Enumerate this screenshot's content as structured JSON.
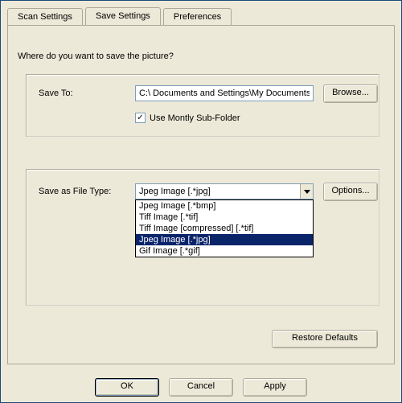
{
  "tabs": {
    "scan": "Scan Settings",
    "save": "Save Settings",
    "prefs": "Preferences"
  },
  "prompt": "Where do you want to save the picture?",
  "save_to": {
    "label": "Save To:",
    "value": "C:\\ Documents and Settings\\My Documents",
    "browse": "Browse..."
  },
  "monthly": {
    "label": "Use Montly Sub-Folder",
    "checked": true
  },
  "file_type": {
    "label": "Save as File Type:",
    "selected": "Jpeg Image [.*jpg]",
    "options_btn": "Options...",
    "options": [
      "Jpeg Image [.*bmp]",
      "Tiff Image [.*tif]",
      "Tiff Image [compressed] [.*tif]",
      "Jpeg Image [.*jpg]",
      "Gif Image [.*gif]"
    ]
  },
  "restore": "Restore Defaults",
  "buttons": {
    "ok": "OK",
    "cancel": "Cancel",
    "apply": "Apply"
  },
  "checkmark": "✓"
}
